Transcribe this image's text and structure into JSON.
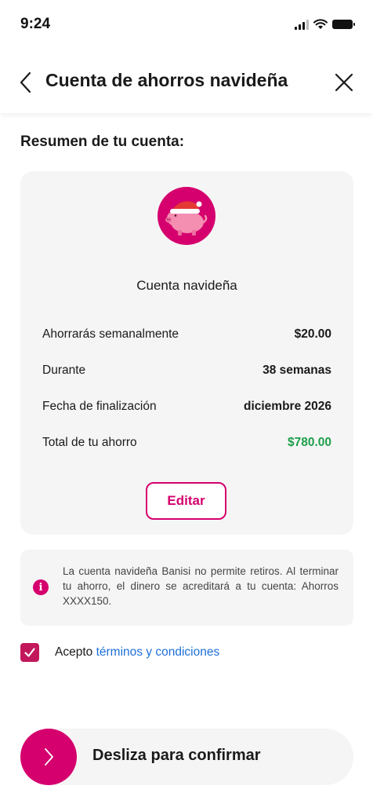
{
  "status_bar": {
    "time": "9:24",
    "icons": [
      "signal-icon",
      "wifi-icon",
      "battery-icon"
    ]
  },
  "header": {
    "title": "Cuenta de ahorros navideña",
    "back_icon": "chevron-left-icon",
    "close_icon": "close-icon"
  },
  "summary": {
    "section_title": "Resumen de tu cuenta:",
    "account_name": "Cuenta navideña",
    "avatar_icon": "piggy-bank-santa-hat-icon",
    "rows": [
      {
        "label": "Ahorrarás semanalmente",
        "value": "$20.00"
      },
      {
        "label": "Durante",
        "value": "38 semanas"
      },
      {
        "label": "Fecha de finalización",
        "value": "diciembre 2026"
      },
      {
        "label": "Total de tu ahorro",
        "value": "$780.00"
      }
    ],
    "edit_label": "Editar"
  },
  "info": {
    "icon": "info-icon",
    "text": "La cuenta navideña Banisi no permite retiros. Al terminar tu ahorro, el dinero se acreditará a tu cuenta: Ahorros XXXX150."
  },
  "terms": {
    "checked": true,
    "prefix": "Acepto ",
    "link": "términos y condiciones"
  },
  "confirm": {
    "label": "Desliza para confirmar",
    "icon": "chevron-right-icon"
  },
  "colors": {
    "brand": "#d5006d",
    "positive": "#1e9e4a",
    "link": "#1e6fd9",
    "card_bg": "#f5f5f5"
  }
}
